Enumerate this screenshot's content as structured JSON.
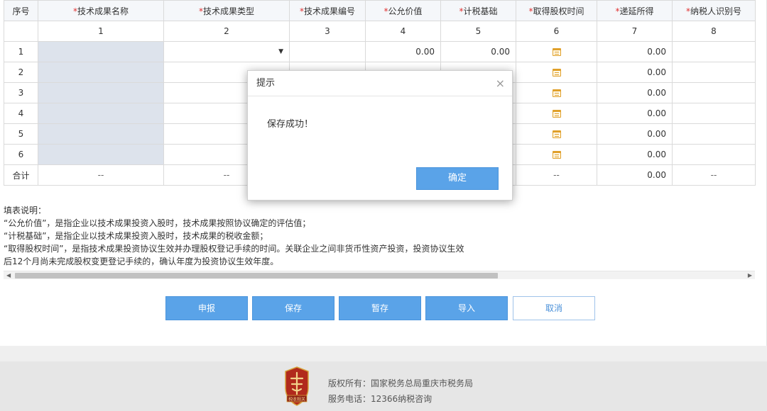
{
  "table": {
    "headers": [
      {
        "required": false,
        "label": "序号"
      },
      {
        "required": true,
        "label": "技术成果名称"
      },
      {
        "required": true,
        "label": "技术成果类型"
      },
      {
        "required": true,
        "label": "技术成果编号"
      },
      {
        "required": true,
        "label": "公允价值"
      },
      {
        "required": true,
        "label": "计税基础"
      },
      {
        "required": true,
        "label": "取得股权时间"
      },
      {
        "required": true,
        "label": "递延所得"
      },
      {
        "required": true,
        "label": "纳税人识别号"
      }
    ],
    "col_numbers": [
      "1",
      "2",
      "3",
      "4",
      "5",
      "6",
      "7",
      "8"
    ],
    "rows": [
      {
        "seq": "1",
        "fair_value": "0.00",
        "tax_basis": "0.00",
        "deferred": "0.00"
      },
      {
        "seq": "2",
        "fair_value": "",
        "tax_basis": "",
        "deferred": "0.00"
      },
      {
        "seq": "3",
        "fair_value": "",
        "tax_basis": "",
        "deferred": "0.00"
      },
      {
        "seq": "4",
        "fair_value": "",
        "tax_basis": "",
        "deferred": "0.00"
      },
      {
        "seq": "5",
        "fair_value": "",
        "tax_basis": "",
        "deferred": "0.00"
      },
      {
        "seq": "6",
        "fair_value": "",
        "tax_basis": "",
        "deferred": "0.00"
      }
    ],
    "total": {
      "label": "合计",
      "name": "--",
      "type": "--",
      "date": "--",
      "deferred": "0.00",
      "taxpayer": "--"
    },
    "type_caret": "▼",
    "required_mark": "*"
  },
  "notes": {
    "title": "填表说明：",
    "lines": [
      "“公允价值”，是指企业以技术成果投资入股时，技术成果按照协议确定的评估值；",
      "“计税基础”，是指企业以技术成果投资入股时，技术成果的税收金额；",
      "“取得股权时间”，是指技术成果投资协议生效并办理股权登记手续的时间。关联企业之间非货币性资产投资，投资协议生效",
      "后12个月尚未完成股权变更登记手续的，确认年度为投资协议生效年度。"
    ]
  },
  "buttons": {
    "declare": "申报",
    "save": "保存",
    "temp_save": "暂存",
    "import": "导入",
    "cancel": "取消"
  },
  "dialog": {
    "title": "提示",
    "message": "保存成功！",
    "ok": "确定",
    "close": "×"
  },
  "footer": {
    "copyright": "版权所有：国家税务总局重庆市税务局",
    "phone": "服务电话：12366纳税咨询",
    "logo_text": "税收相关"
  },
  "scrollbar": {
    "left_arrow": "◀",
    "right_arrow": "▶",
    "position": 0.0
  },
  "colors": {
    "primary_button": "#5aa3e8",
    "required": "#e03030",
    "name_cell": "#dde3ec",
    "calendar_icon": "#e0a02a"
  }
}
